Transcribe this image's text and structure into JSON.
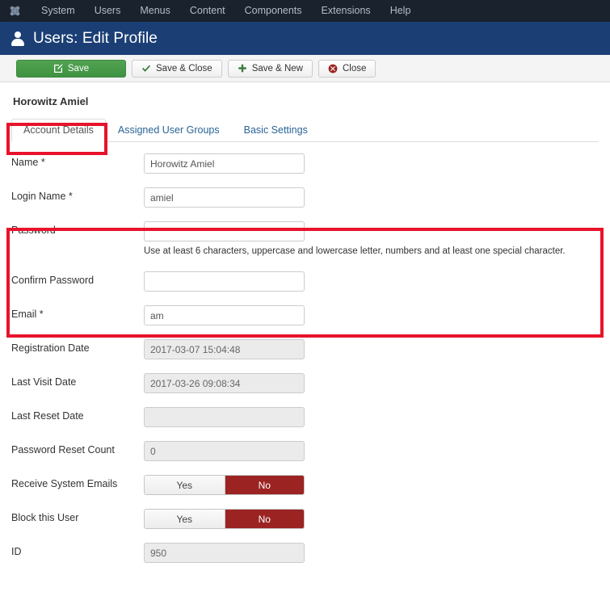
{
  "topnav": {
    "logo_icon": "joomla-logo-icon",
    "items": [
      {
        "label": "System"
      },
      {
        "label": "Users"
      },
      {
        "label": "Menus"
      },
      {
        "label": "Content"
      },
      {
        "label": "Components"
      },
      {
        "label": "Extensions"
      },
      {
        "label": "Help"
      }
    ]
  },
  "header": {
    "icon": "user-icon",
    "title": "Users: Edit Profile"
  },
  "toolbar": {
    "save": {
      "label": "Save",
      "icon": "edit-pencil-icon"
    },
    "save_close": {
      "label": "Save & Close",
      "icon": "check-icon"
    },
    "save_new": {
      "label": "Save & New",
      "icon": "plus-icon"
    },
    "close": {
      "label": "Close",
      "icon": "cancel-circle-icon"
    }
  },
  "content": {
    "user_heading": "Horowitz Amiel",
    "tabs": [
      {
        "label": "Account Details",
        "active": true
      },
      {
        "label": "Assigned User Groups",
        "active": false
      },
      {
        "label": "Basic Settings",
        "active": false
      }
    ]
  },
  "form": {
    "name": {
      "label": "Name *",
      "value": "Horowitz Amiel"
    },
    "login_name": {
      "label": "Login Name *",
      "value": "amiel"
    },
    "password": {
      "label": "Password",
      "value": "",
      "help": "Use at least 6 characters, uppercase and lowercase letter, numbers and at least one special character."
    },
    "confirm_password": {
      "label": "Confirm Password",
      "value": ""
    },
    "email": {
      "label": "Email *",
      "value": "am"
    },
    "registration_date": {
      "label": "Registration Date",
      "value": "2017-03-07 15:04:48"
    },
    "last_visit_date": {
      "label": "Last Visit Date",
      "value": "2017-03-26 09:08:34"
    },
    "last_reset_date": {
      "label": "Last Reset Date",
      "value": ""
    },
    "password_reset_count": {
      "label": "Password Reset Count",
      "value": "0"
    },
    "receive_system_emails": {
      "label": "Receive System Emails",
      "yes_label": "Yes",
      "no_label": "No",
      "selected": "No"
    },
    "block_this_user": {
      "label": "Block this User",
      "yes_label": "Yes",
      "no_label": "No",
      "selected": "No"
    },
    "id": {
      "label": "ID",
      "value": "950"
    }
  },
  "highlights": {
    "color": "#e8132b",
    "regions": [
      "account-details-tab",
      "password-email-section"
    ]
  },
  "colors": {
    "topnav_bg": "#1a222e",
    "titlebar_bg": "#1b3f75",
    "toolbar_bg": "#f4f4f4",
    "save_button_green": "#44923f",
    "toggle_no_red": "#9b2423",
    "tab_link_blue": "#2a6496",
    "highlight_red": "#e8132b"
  }
}
